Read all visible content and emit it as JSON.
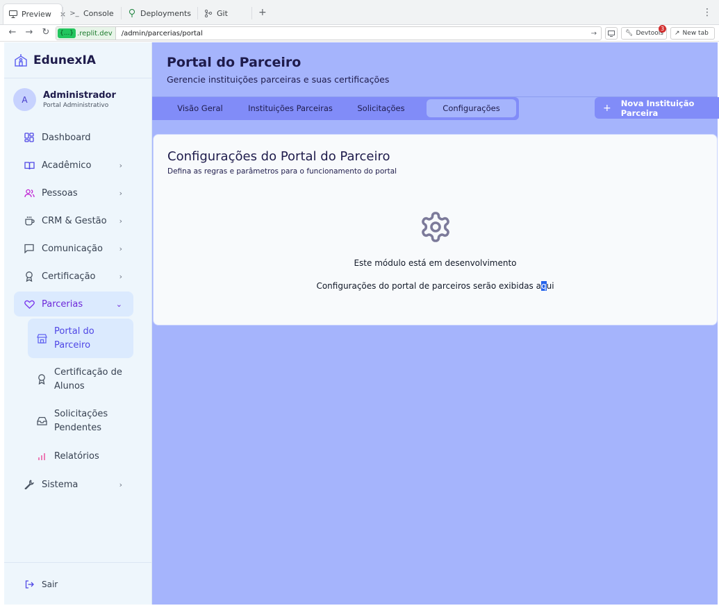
{
  "browser": {
    "tabs": [
      {
        "label": "Preview",
        "close": "×",
        "icon": "monitor-icon"
      },
      {
        "label": "Console",
        "icon": "terminal-icon",
        "glyph": ">_"
      },
      {
        "label": "Deployments",
        "icon": "deploy-icon"
      },
      {
        "label": "Git",
        "icon": "git-icon"
      }
    ],
    "new_tab_plus": "+",
    "menu": "⋮",
    "url_domain": ".replit.dev",
    "url_badge": "{...}",
    "url_path": "/admin/parcerias/portal",
    "devtools_label": "Devtools",
    "devtools_count": "3",
    "newtab_label": "New tab"
  },
  "sidebar": {
    "brand": "EdunexIA",
    "user": {
      "initial": "A",
      "name": "Administrador",
      "role": "Portal Administrativo"
    },
    "items": [
      {
        "label": "Dashboard",
        "icon": "grid-icon"
      },
      {
        "label": "Acadêmico",
        "icon": "book-icon"
      },
      {
        "label": "Pessoas",
        "icon": "users-icon"
      },
      {
        "label": "CRM & Gestão",
        "icon": "cup-icon"
      },
      {
        "label": "Comunicação",
        "icon": "message-icon"
      },
      {
        "label": "Certificação",
        "icon": "award-icon"
      },
      {
        "label": "Parcerias",
        "icon": "heart-icon"
      }
    ],
    "subitems": [
      {
        "label": "Portal do Parceiro",
        "icon": "store-icon"
      },
      {
        "label": "Certificação de Alunos",
        "icon": "award-icon"
      },
      {
        "label": "Solicitações Pendentes",
        "icon": "inbox-icon"
      },
      {
        "label": "Relatórios",
        "icon": "bar-chart-icon"
      }
    ],
    "system": {
      "label": "Sistema",
      "icon": "wrench-icon"
    },
    "logout": {
      "label": "Sair",
      "icon": "logout-icon"
    }
  },
  "main": {
    "title": "Portal do Parceiro",
    "subtitle": "Gerencie instituições parceiras e suas certificações",
    "tabs": [
      "Visão Geral",
      "Instituições Parceiras",
      "Solicitações",
      "Configurações"
    ],
    "active_tab": "Configurações",
    "new_button": "Nova Instituição Parceira",
    "new_button_icon": "+",
    "card": {
      "title": "Configurações do Portal do Parceiro",
      "description": "Defina as regras e parâmetros para o funcionamento do portal",
      "status": "Este módulo está em desenvolvimento",
      "message_before": "Configurações do portal de parceiros serão exibidas a",
      "message_selected": "q",
      "message_after": "ui"
    }
  },
  "colors": {
    "main_bg": "#a5b4fc",
    "tabs_bg": "#818cf8",
    "sidebar_bg": "#eef6fc",
    "accent": "#6d28d9"
  }
}
